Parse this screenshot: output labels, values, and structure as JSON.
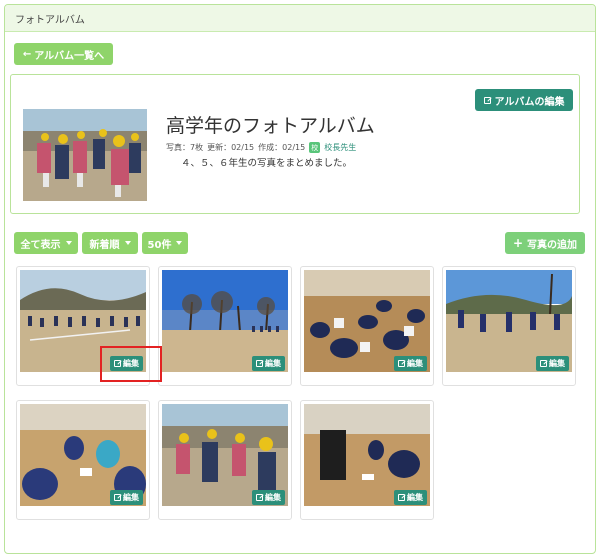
{
  "panel": {
    "title": "フォトアルバム"
  },
  "nav": {
    "back_label": "アルバム一覧へ",
    "back_icon": "arrow-left-icon"
  },
  "album": {
    "title": "高学年のフォトアルバム",
    "photos_label": "写真：7枚",
    "updated_label": "更新：02/15",
    "created_label": "作成：02/15",
    "badge": "校",
    "author": "校長先生",
    "description": "４、５、６年生の写真をまとめました。",
    "edit_album_label": "アルバムの編集"
  },
  "toolbar": {
    "show_all_label": "全て表示",
    "sort_label": "新着順",
    "per_page_label": "50件",
    "add_photo_label": "写真の追加"
  },
  "photos": [
    {
      "edit_label": "編集"
    },
    {
      "edit_label": "編集"
    },
    {
      "edit_label": "編集"
    },
    {
      "edit_label": "編集"
    },
    {
      "edit_label": "編集"
    },
    {
      "edit_label": "編集"
    },
    {
      "edit_label": "編集"
    }
  ],
  "colors": {
    "green": "#8fd46a",
    "teal": "#2c8f7a",
    "border": "#b9e39a",
    "highlight": "#e32222"
  }
}
